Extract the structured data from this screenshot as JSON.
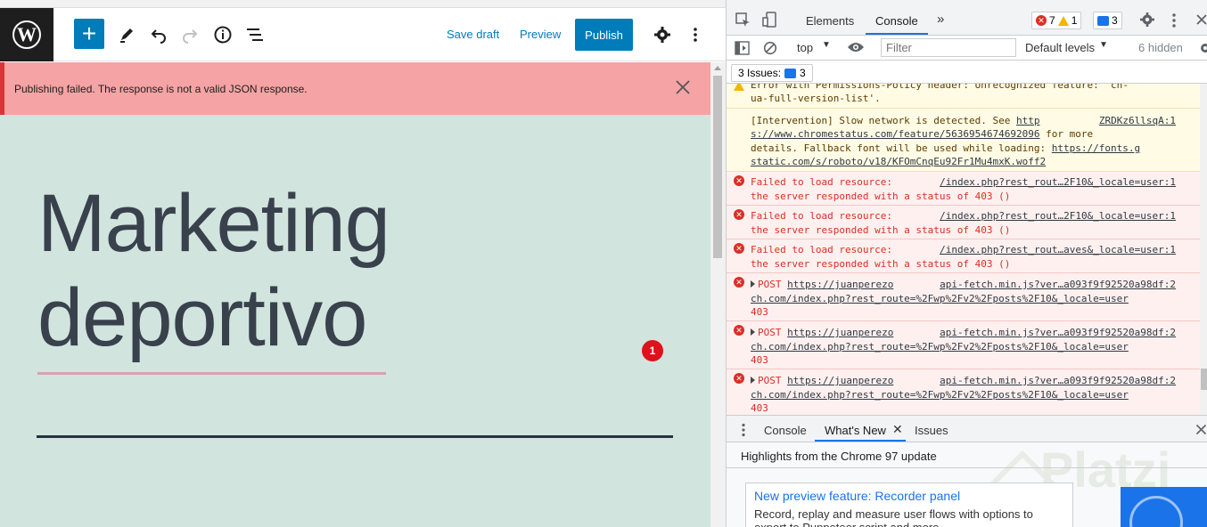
{
  "wp": {
    "toolbar": {
      "save_draft": "Save draft",
      "preview": "Preview",
      "publish": "Publish"
    },
    "notice": {
      "message": "Publishing failed. The response is not a valid JSON response."
    },
    "post": {
      "title_line1": "Marketing",
      "title_line2": "deportivo"
    },
    "badge": "1"
  },
  "devtools": {
    "tabs": {
      "elements": "Elements",
      "console": "Console",
      "more": "»"
    },
    "counters": {
      "errors": "7",
      "warnings": "1",
      "messages": "3"
    },
    "filterbar": {
      "context": "top",
      "filter_placeholder": "Filter",
      "levels": "Default levels",
      "hidden": "6 hidden"
    },
    "issues": {
      "label": "3 Issues:",
      "count": "3"
    },
    "console": {
      "warn_top_line1": "Error with Permissions-Policy header: Unrecognized feature: 'ch-",
      "warn_top_line2": "ua-full-version-list'.",
      "intervention": {
        "line1": "[Intervention] Slow network is detected. See ",
        "link1": "http",
        "source": "ZRDKz6llsqA:1",
        "line2_link": "s://www.chromestatus.com/feature/5636954674692096",
        "line2_rest": " for more",
        "line3": "details. Fallback font will be used while loading: ",
        "line3_link": "https://fonts.g",
        "line4_link": "static.com/s/roboto/v18/KFOmCnqEu92Fr1Mu4mxK.woff2"
      },
      "fails": [
        {
          "text": "Failed to load resource: ",
          "source": "/index.php?rest_rout…2F10&_locale=user:1",
          "line2": "the server responded with a status of 403 ()"
        },
        {
          "text": "Failed to load resource: ",
          "source": "/index.php?rest_rout…2F10&_locale=user:1",
          "line2": "the server responded with a status of 403 ()"
        },
        {
          "text": "Failed to load resource: ",
          "source": "/index.php?rest_rout…aves&_locale=user:1",
          "line2": "the server responded with a status of 403 ()"
        }
      ],
      "posts": [
        {
          "method": "POST ",
          "url": "https://juanperezo",
          "source": "api-fetch.min.js?ver…a093f9f92520a98df:2",
          "line2": "ch.com/index.php?rest_route=%2Fwp%2Fv2%2Fposts%2F10&_locale=user",
          "status": "403"
        },
        {
          "method": "POST ",
          "url": "https://juanperezo",
          "source": "api-fetch.min.js?ver…a093f9f92520a98df:2",
          "line2": "ch.com/index.php?rest_route=%2Fwp%2Fv2%2Fposts%2F10&_locale=user",
          "status": "403"
        },
        {
          "method": "POST ",
          "url": "https://juanperezo",
          "source": "api-fetch.min.js?ver…a093f9f92520a98df:2",
          "line2": "ch.com/index.php?rest_route=%2Fwp%2Fv2%2Fposts%2F10&_locale=user",
          "status": "403"
        }
      ]
    },
    "drawer": {
      "tab_console": "Console",
      "tab_whats_new": "What's New",
      "tab_issues": "Issues",
      "highlights": "Highlights from the Chrome 97 update",
      "card_title": "New preview feature: Recorder panel",
      "card_desc": "Record, replay and measure user flows with options to export to Puppeteer script and more."
    },
    "watermark": "Platzi"
  }
}
